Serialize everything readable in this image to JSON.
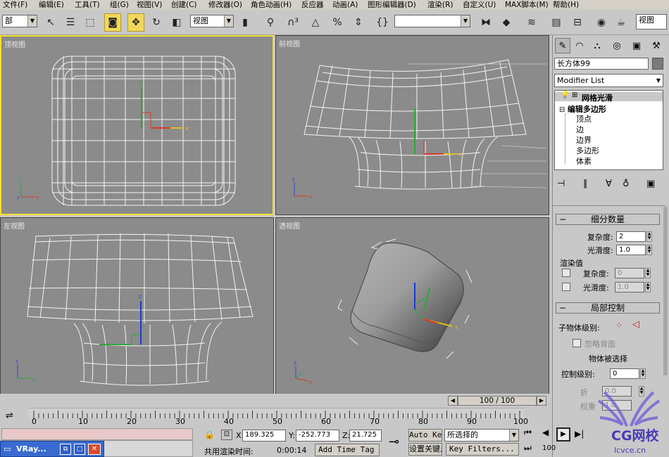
{
  "menu": [
    "文件(F)",
    "编辑(E)",
    "工具(T)",
    "组(G)",
    "视图(V)",
    "创建(C)",
    "修改器(O)",
    "角色动画(H)",
    "反应器",
    "动画(A)",
    "图形编辑器(D)",
    "渲染(R)",
    "自定义(U)",
    "MAX脚本(M)",
    "帮助(H)"
  ],
  "toolbar": {
    "selection_filter": "部",
    "ref_coord": "视图",
    "named_sel": "",
    "right_combo": "视图"
  },
  "viewports": {
    "top": "顶视图",
    "front": "前视图",
    "left": "左视图",
    "persp": "透视图"
  },
  "axes": {
    "x": "x",
    "y": "y",
    "z": "z"
  },
  "command_panel": {
    "object_name": "长方体99",
    "modifier_list": "Modifier List",
    "stack": [
      {
        "label": "网格光滑",
        "type": "top"
      },
      {
        "label": "编辑多边形",
        "type": "base"
      },
      {
        "label": "顶点",
        "type": "sub"
      },
      {
        "label": "边",
        "type": "sub"
      },
      {
        "label": "边界",
        "type": "sub"
      },
      {
        "label": "多边形",
        "type": "sub"
      },
      {
        "label": "体素",
        "type": "sub"
      }
    ],
    "rollout_subdiv": "细分数量",
    "complexity_label": "复杂度:",
    "complexity_value": "2",
    "smoothness_label": "光滑度:",
    "smoothness_value": "1.0",
    "render_values": "渲染值",
    "r_complexity_value": "0",
    "r_smoothness_value": "1.0",
    "rollout_local": "局部控制",
    "sublevel": "子物体级别:",
    "ignore_backface": "忽略背面",
    "obj_selected": "物体被选择",
    "control_level": "控制级别:",
    "control_level_value": "0",
    "crease": "折",
    "crease_value": "0.0",
    "weight": "权重",
    "weight_value": "1.0"
  },
  "timeline": {
    "frame": "100 / 100",
    "ticks": [
      "0",
      "10",
      "20",
      "30",
      "40",
      "50",
      "60",
      "70",
      "80",
      "90",
      "100"
    ]
  },
  "status": {
    "x_label": "X:",
    "x": "189.325",
    "y_label": "Y:",
    "y": "-252.773",
    "z_label": "Z:",
    "z": "21.725",
    "auto_key": "Auto Key",
    "selected": "所选择的",
    "set_key": "设置关键点",
    "key_filters": "Key Filters...",
    "render_time_label": "共用渲染时间:",
    "render_time": "0:00:14",
    "add_time_tag": "Add Time Tag"
  },
  "taskbar": {
    "app": "VRay..."
  },
  "watermark": {
    "text": "CG网校",
    "url": "lcvce.cn"
  }
}
